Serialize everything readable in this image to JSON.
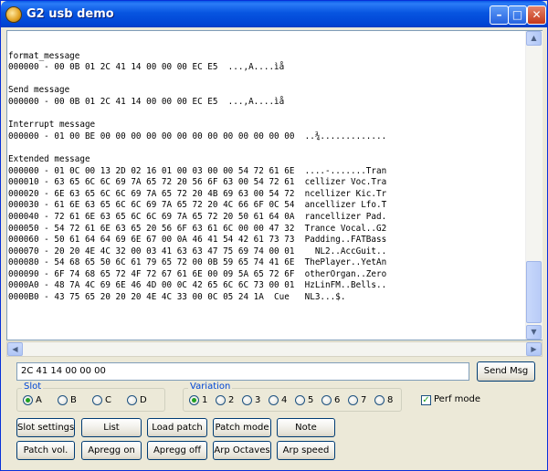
{
  "window": {
    "title": "G2 usb demo"
  },
  "log_lines": [
    "",
    "format_message",
    "000000 - 00 0B 01 2C 41 14 00 00 00 EC E5  ...,A....ìå",
    "",
    "Send message",
    "000000 - 00 0B 01 2C 41 14 00 00 00 EC E5  ...,A....ìå",
    "",
    "Interrupt message",
    "000000 - 01 00 BE 00 00 00 00 00 00 00 00 00 00 00 00 00  ..¾.............",
    "",
    "Extended message",
    "000000 - 01 0C 00 13 2D 02 16 01 00 03 00 00 54 72 61 6E  ....-.......Tran",
    "000010 - 63 65 6C 6C 69 7A 65 72 20 56 6F 63 00 54 72 61  cellizer Voc.Tra",
    "000020 - 6E 63 65 6C 6C 69 7A 65 72 20 4B 69 63 00 54 72  ncellizer Kic.Tr",
    "000030 - 61 6E 63 65 6C 6C 69 7A 65 72 20 4C 66 6F 0C 54  ancellizer Lfo.T",
    "000040 - 72 61 6E 63 65 6C 6C 69 7A 65 72 20 50 61 64 0A  rancellizer Pad.",
    "000050 - 54 72 61 6E 63 65 20 56 6F 63 61 6C 00 00 47 32  Trance Vocal..G2",
    "000060 - 50 61 64 64 69 6E 67 00 0A 46 41 54 42 61 73 73  Padding..FATBass",
    "000070 - 20 20 4E 4C 32 00 03 41 63 63 47 75 69 74 00 01    NL2..AccGuit..",
    "000080 - 54 68 65 50 6C 61 79 65 72 00 0B 59 65 74 41 6E  ThePlayer..YetAn",
    "000090 - 6F 74 68 65 72 4F 72 67 61 6E 00 09 5A 65 72 6F  otherOrgan..Zero",
    "0000A0 - 48 7A 4C 69 6E 46 4D 00 0C 42 65 6C 6C 73 00 01  HzLinFM..Bells..",
    "0000B0 - 43 75 65 20 20 20 4E 4C 33 00 0C 05 24 1A  Cue   NL3...$."
  ],
  "command": {
    "value": "2C 41 14 00 00 00"
  },
  "send_button": "Send Msg",
  "slot": {
    "label": "Slot",
    "options": [
      "A",
      "B",
      "C",
      "D"
    ],
    "selected": "A"
  },
  "variation": {
    "label": "Variation",
    "options": [
      "1",
      "2",
      "3",
      "4",
      "5",
      "6",
      "7",
      "8"
    ],
    "selected": "1"
  },
  "perf_mode": {
    "label": "Perf mode",
    "checked": true
  },
  "buttons_row1": [
    "Slot settings",
    "List",
    "Load patch",
    "Patch mode",
    "Note"
  ],
  "buttons_row2": [
    "Patch vol.",
    "Apregg on",
    "Apregg off",
    "Arp Octaves",
    "Arp speed"
  ],
  "colors": {
    "title_bar": "#0054e3",
    "group_label": "#0046d5",
    "radio_checked": "#21a121"
  }
}
